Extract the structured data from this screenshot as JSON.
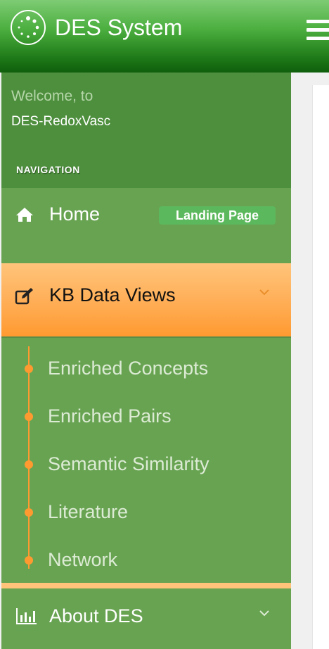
{
  "header": {
    "app_title": "DES System",
    "logo_icon": "loading-dots-icon",
    "menu_icon": "hamburger-menu-icon"
  },
  "sidebar": {
    "welcome_line1": "Welcome, to",
    "welcome_line2": "DES-RedoxVasc",
    "nav_header": "NAVIGATION",
    "home": {
      "label": "Home",
      "icon": "home-icon",
      "badge": "Landing Page"
    },
    "kb": {
      "label": "KB Data Views",
      "icon": "edit-icon",
      "expanded": true,
      "items": [
        {
          "label": "Enriched Concepts"
        },
        {
          "label": "Enriched Pairs"
        },
        {
          "label": "Semantic Similarity"
        },
        {
          "label": "Literature"
        },
        {
          "label": "Network"
        }
      ]
    },
    "about": {
      "label": "About DES",
      "icon": "bar-chart-icon"
    }
  },
  "colors": {
    "header_green": "#4caf3f",
    "sidebar_green": "#68a352",
    "active_orange": "#ffad55",
    "badge_green": "#5cb85c",
    "submenu_accent": "#ff9a30"
  }
}
